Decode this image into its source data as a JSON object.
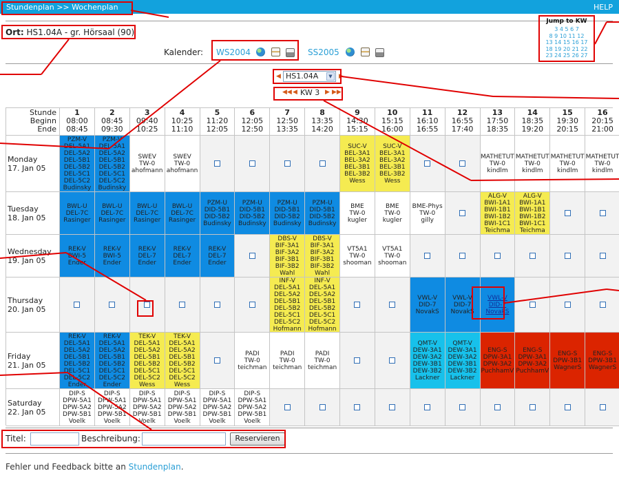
{
  "header": {
    "breadcrumb": "Stundenplan >> Wochenplan",
    "help": "HELP"
  },
  "location": {
    "label": "Ort:",
    "value": "HS1.04A - gr. Hörsaal (90)"
  },
  "calendars": {
    "label": "Kalender:",
    "items": [
      "WS2004",
      "SS2005"
    ]
  },
  "jump": {
    "title": "Jump to KW",
    "rows": [
      "3 4 5 6 7",
      "8 9 10 11 12",
      "13 14 15 16 17",
      "18 19 20 21 22",
      "23 24 25 26 27"
    ]
  },
  "room_select": {
    "value": "HS1.04A"
  },
  "week_select": {
    "value": "KW 3"
  },
  "table": {
    "corner": [
      "Stunde",
      "Beginn",
      "Ende"
    ],
    "slots": [
      {
        "n": "1",
        "b": "08:00",
        "e": "08:45"
      },
      {
        "n": "2",
        "b": "08:45",
        "e": "09:30"
      },
      {
        "n": "3",
        "b": "09:40",
        "e": "10:25"
      },
      {
        "n": "4",
        "b": "10:25",
        "e": "11:10"
      },
      {
        "n": "5",
        "b": "11:20",
        "e": "12:05"
      },
      {
        "n": "6",
        "b": "12:05",
        "e": "12:50"
      },
      {
        "n": "7",
        "b": "12:50",
        "e": "13:35"
      },
      {
        "n": "8",
        "b": "13:35",
        "e": "14:20"
      },
      {
        "n": "9",
        "b": "14:30",
        "e": "15:15"
      },
      {
        "n": "10",
        "b": "15:15",
        "e": "16:00"
      },
      {
        "n": "11",
        "b": "16:10",
        "e": "16:55"
      },
      {
        "n": "12",
        "b": "16:55",
        "e": "17:40"
      },
      {
        "n": "13",
        "b": "17:50",
        "e": "18:35"
      },
      {
        "n": "14",
        "b": "18:35",
        "e": "19:20"
      },
      {
        "n": "15",
        "b": "19:30",
        "e": "20:15"
      },
      {
        "n": "16",
        "b": "20:15",
        "e": "21:00"
      }
    ],
    "days": [
      {
        "name": "Monday",
        "date": "17. Jan 05",
        "cells": [
          {
            "c": "blue",
            "t": [
              "PZM-V",
              "DEL-5A1",
              "DEL-5A2",
              "DEL-5B1",
              "DEL-5B2",
              "DEL-5C1",
              "DEL-5C2",
              "Budinsky"
            ]
          },
          {
            "c": "blue",
            "t": [
              "PZM-V",
              "DEL-5A1",
              "DEL-5A2",
              "DEL-5B1",
              "DEL-5B2",
              "DEL-5C1",
              "DEL-5C2",
              "Budinsky"
            ]
          },
          {
            "c": "white",
            "t": [
              "SWEV",
              "TW-0",
              "ahofmann"
            ]
          },
          {
            "c": "white",
            "t": [
              "SWEV",
              "TW-0",
              "ahofmann"
            ]
          },
          null,
          null,
          null,
          null,
          {
            "c": "yellow",
            "t": [
              "SUC-V",
              "BEL-3A1",
              "BEL-3A2",
              "BEL-3B1",
              "BEL-3B2",
              "Wess"
            ]
          },
          {
            "c": "yellow",
            "t": [
              "SUC-V",
              "BEL-3A1",
              "BEL-3A2",
              "BEL-3B1",
              "BEL-3B2",
              "Wess"
            ]
          },
          null,
          null,
          {
            "c": "white",
            "t": [
              "MATHETUT",
              "TW-0",
              "kindlm"
            ]
          },
          {
            "c": "white",
            "t": [
              "MATHETUT",
              "TW-0",
              "kindlm"
            ]
          },
          {
            "c": "white",
            "t": [
              "MATHETUT",
              "TW-0",
              "kindlm"
            ]
          },
          {
            "c": "white",
            "t": [
              "MATHETUT",
              "TW-0",
              "kindlm"
            ]
          }
        ]
      },
      {
        "name": "Tuesday",
        "date": "18. Jan 05",
        "cells": [
          {
            "c": "blue",
            "t": [
              "BWL-U",
              "DEL-7C",
              "Rasinger"
            ]
          },
          {
            "c": "blue",
            "t": [
              "BWL-U",
              "DEL-7C",
              "Rasinger"
            ]
          },
          {
            "c": "blue",
            "t": [
              "BWL-U",
              "DEL-7C",
              "Rasinger"
            ]
          },
          {
            "c": "blue",
            "t": [
              "BWL-U",
              "DEL-7C",
              "Rasinger"
            ]
          },
          {
            "c": "blue",
            "t": [
              "PZM-U",
              "DID-5B1",
              "DID-5B2",
              "Budinsky"
            ]
          },
          {
            "c": "blue",
            "t": [
              "PZM-U",
              "DID-5B1",
              "DID-5B2",
              "Budinsky"
            ]
          },
          {
            "c": "blue",
            "t": [
              "PZM-U",
              "DID-5B1",
              "DID-5B2",
              "Budinsky"
            ]
          },
          {
            "c": "blue",
            "t": [
              "PZM-U",
              "DID-5B1",
              "DID-5B2",
              "Budinsky"
            ]
          },
          {
            "c": "white",
            "t": [
              "BME",
              "TW-0",
              "kugler"
            ]
          },
          {
            "c": "white",
            "t": [
              "BME",
              "TW-0",
              "kugler"
            ]
          },
          {
            "c": "white",
            "t": [
              "BME-Phys",
              "TW-0",
              "gilly"
            ]
          },
          null,
          {
            "c": "yellow",
            "t": [
              "ALG-V",
              "BWI-1A1",
              "BWI-1B1",
              "BWI-1B2",
              "BWI-1C1",
              "Teichma"
            ]
          },
          {
            "c": "yellow",
            "t": [
              "ALG-V",
              "BWI-1A1",
              "BWI-1B1",
              "BWI-1B2",
              "BWI-1C1",
              "Teichma"
            ]
          },
          null,
          null
        ]
      },
      {
        "name": "Wednesday",
        "date": "19. Jan 05",
        "cells": [
          {
            "c": "blue",
            "t": [
              "REK-V",
              "BWI-5",
              "Ender"
            ]
          },
          {
            "c": "blue",
            "t": [
              "REK-V",
              "BWI-5",
              "Ender"
            ]
          },
          {
            "c": "blue",
            "t": [
              "REK-V",
              "DEL-7",
              "Ender"
            ]
          },
          {
            "c": "blue",
            "t": [
              "REK-V",
              "DEL-7",
              "Ender"
            ]
          },
          {
            "c": "blue",
            "t": [
              "REK-V",
              "DEL-7",
              "Ender"
            ]
          },
          null,
          {
            "c": "yellow",
            "t": [
              "DBS-V",
              "BIF-3A1",
              "BIF-3A2",
              "BIF-3B1",
              "BIF-3B2",
              "Wahl"
            ]
          },
          {
            "c": "yellow",
            "t": [
              "DBS-V",
              "BIF-3A1",
              "BIF-3A2",
              "BIF-3B1",
              "BIF-3B2",
              "Wahl"
            ]
          },
          {
            "c": "white",
            "t": [
              "VT5A1",
              "TW-0",
              "shooman"
            ]
          },
          {
            "c": "white",
            "t": [
              "VT5A1",
              "TW-0",
              "shooman"
            ]
          },
          null,
          null,
          null,
          null,
          null,
          null
        ]
      },
      {
        "name": "Thursday",
        "date": "20. Jan 05",
        "cells": [
          null,
          null,
          null,
          null,
          null,
          null,
          {
            "c": "yellow",
            "t": [
              "INF-V",
              "DEL-5A1",
              "DEL-5A2",
              "DEL-5B1",
              "DEL-5B2",
              "DEL-5C1",
              "DEL-5C2",
              "Hofmann"
            ]
          },
          {
            "c": "yellow",
            "t": [
              "INF-V",
              "DEL-5A1",
              "DEL-5A2",
              "DEL-5B1",
              "DEL-5B2",
              "DEL-5C1",
              "DEL-5C2",
              "Hofmann"
            ]
          },
          null,
          null,
          {
            "c": "blue",
            "t": [
              "VWL-V",
              "DID-7",
              "NovakS"
            ]
          },
          {
            "c": "blue",
            "t": [
              "VWL-V",
              "DID-7",
              "NovakS"
            ]
          },
          {
            "c": "blue",
            "t": [
              "VWL-V",
              "DID-7",
              "NovakS"
            ],
            "link": true
          },
          null,
          null,
          null
        ]
      },
      {
        "name": "Friday",
        "date": "21. Jan 05",
        "cells": [
          {
            "c": "blue",
            "t": [
              "REK-V",
              "DEL-5A1",
              "DEL-5A2",
              "DEL-5B1",
              "DEL-5B2",
              "DEL-5C1",
              "DEL-5C2",
              "Ender"
            ]
          },
          {
            "c": "blue",
            "t": [
              "REK-V",
              "DEL-5A1",
              "DEL-5A2",
              "DEL-5B1",
              "DEL-5B2",
              "DEL-5C1",
              "DEL-5C2",
              "Ender"
            ]
          },
          {
            "c": "yellow",
            "t": [
              "TEK-V",
              "DEL-5A1",
              "DEL-5A2",
              "DEL-5B1",
              "DEL-5B2",
              "DEL-5C1",
              "DEL-5C2",
              "Wess"
            ]
          },
          {
            "c": "yellow",
            "t": [
              "TEK-V",
              "DEL-5A1",
              "DEL-5A2",
              "DEL-5B1",
              "DEL-5B2",
              "DEL-5C1",
              "DEL-5C2",
              "Wess"
            ]
          },
          null,
          {
            "c": "white",
            "t": [
              "PADI",
              "TW-0",
              "teichman"
            ]
          },
          {
            "c": "white",
            "t": [
              "PADI",
              "TW-0",
              "teichman"
            ]
          },
          {
            "c": "white",
            "t": [
              "PADI",
              "TW-0",
              "teichman"
            ]
          },
          null,
          null,
          {
            "c": "cyan",
            "t": [
              "QMT-V",
              "DEW-3A1",
              "DEW-3A2",
              "DEW-3B1",
              "DEW-3B2",
              "Lackner"
            ]
          },
          {
            "c": "cyan",
            "t": [
              "QMT-V",
              "DEW-3A1",
              "DEW-3A2",
              "DEW-3B1",
              "DEW-3B2",
              "Lackner"
            ]
          },
          {
            "c": "red",
            "t": [
              "ENG-S",
              "DPW-3A1",
              "DPW-3A2",
              "PuchhamV"
            ]
          },
          {
            "c": "red",
            "t": [
              "ENG-S",
              "DPW-3A1",
              "DPW-3A2",
              "PuchhamV"
            ]
          },
          {
            "c": "red",
            "t": [
              "ENG-S",
              "DPW-3B1",
              "WagnerS"
            ]
          },
          {
            "c": "red",
            "t": [
              "ENG-S",
              "DPW-3B1",
              "WagnerS"
            ]
          }
        ]
      },
      {
        "name": "Saturday",
        "date": "22. Jan 05",
        "cells": [
          {
            "c": "white",
            "t": [
              "DIP-S",
              "DPW-5A1",
              "DPW-5A2",
              "DPW-5B1",
              "Voelk"
            ]
          },
          {
            "c": "white",
            "t": [
              "DIP-S",
              "DPW-5A1",
              "DPW-5A2",
              "DPW-5B1",
              "Voelk"
            ]
          },
          {
            "c": "white",
            "t": [
              "DIP-S",
              "DPW-5A1",
              "DPW-5A2",
              "DPW-5B1",
              "Voelk"
            ]
          },
          {
            "c": "white",
            "t": [
              "DIP-S",
              "DPW-5A1",
              "DPW-5A2",
              "DPW-5B1",
              "Voelk"
            ]
          },
          {
            "c": "white",
            "t": [
              "DIP-S",
              "DPW-5A1",
              "DPW-5A2",
              "DPW-5B1",
              "Voelk"
            ]
          },
          {
            "c": "white",
            "t": [
              "DIP-S",
              "DPW-5A1",
              "DPW-5A2",
              "DPW-5B1",
              "Voelk"
            ]
          },
          null,
          null,
          null,
          null,
          null,
          null,
          null,
          null,
          null,
          null
        ]
      }
    ]
  },
  "form": {
    "title_label": "Titel:",
    "desc_label": "Beschreibung:",
    "submit": "Reservieren"
  },
  "footer": {
    "text": "Fehler und Feedback bitte an ",
    "link": "Stundenplan",
    "end": "."
  },
  "colors": {
    "blue": "#0f8be2",
    "yellow": "#f5eb51",
    "cyan": "#17c1eb",
    "red": "#db2400",
    "white": "#ffffff",
    "empty": "#f2f2f2",
    "topbar": "#12a2dd",
    "accent": "#2a9fd6",
    "annotation": "#e00000"
  }
}
